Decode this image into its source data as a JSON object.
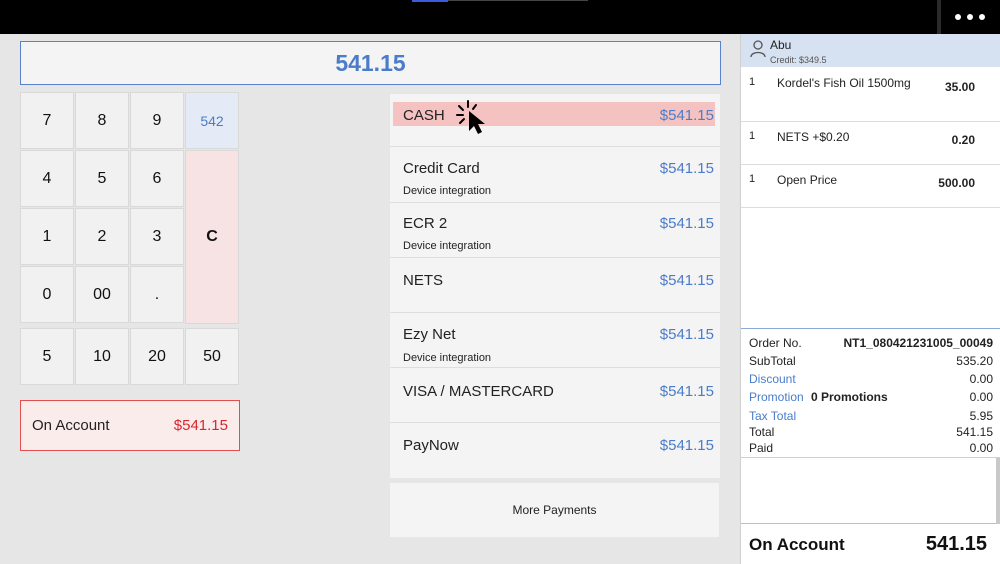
{
  "display": {
    "amount": "541.15"
  },
  "keypad": {
    "keys": [
      "7",
      "8",
      "9",
      "4",
      "5",
      "6",
      "1",
      "2",
      "3",
      "0",
      "00",
      "."
    ],
    "suggest": "542",
    "clear": "C",
    "quick": [
      "5",
      "10",
      "20",
      "50"
    ]
  },
  "on_account_button": {
    "label": "On Account",
    "amount": "$541.15"
  },
  "payments": [
    {
      "name": "CASH",
      "amount": "$541.15",
      "sub": ""
    },
    {
      "name": "Credit Card",
      "amount": "$541.15",
      "sub": "Device integration"
    },
    {
      "name": "ECR 2",
      "amount": "$541.15",
      "sub": "Device integration"
    },
    {
      "name": "NETS",
      "amount": "$541.15",
      "sub": ""
    },
    {
      "name": "Ezy Net",
      "amount": "$541.15",
      "sub": "Device integration"
    },
    {
      "name": "VISA / MASTERCARD",
      "amount": "$541.15",
      "sub": ""
    },
    {
      "name": "PayNow",
      "amount": "$541.15",
      "sub": ""
    }
  ],
  "more_payments": "More Payments",
  "customer": {
    "name": "Abu",
    "credit": "Credit: $349.5"
  },
  "items": [
    {
      "qty": "1",
      "name": "Kordel's Fish Oil 1500mg",
      "price": "35.00"
    },
    {
      "qty": "1",
      "name": "NETS +$0.20",
      "price": "0.20"
    },
    {
      "qty": "1",
      "name": "Open Price",
      "price": "500.00"
    }
  ],
  "summary": {
    "order_no_label": "Order No.",
    "order_no": "NT1_080421231005_00049",
    "subtotal_label": "SubTotal",
    "subtotal": "535.20",
    "discount_label": "Discount",
    "discount": "0.00",
    "promotion_label": "Promotion",
    "promotion_count": "0 Promotions",
    "promotion": "0.00",
    "tax_label": "Tax Total",
    "tax": "5.95",
    "total_label": "Total",
    "total": "541.15",
    "paid_label": "Paid",
    "paid": "0.00"
  },
  "footer": {
    "label": "On Account",
    "amount": "541.15"
  },
  "colors": {
    "accent": "#4a7cc9",
    "danger": "#d8262b",
    "highlight": "#f5c2c2"
  }
}
